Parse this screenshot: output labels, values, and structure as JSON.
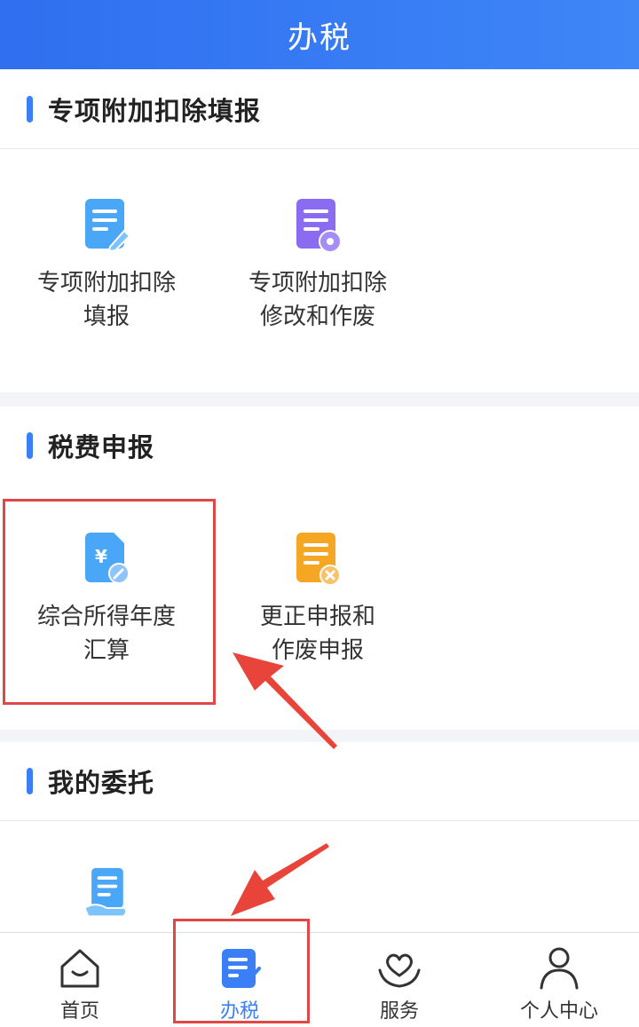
{
  "header": {
    "title": "办税"
  },
  "sections": {
    "special": {
      "title": "专项附加扣除填报",
      "items": [
        {
          "label": "专项附加扣除\n填报",
          "icon": "document-edit-icon",
          "color": "#3fa0f5"
        },
        {
          "label": "专项附加扣除\n修改和作废",
          "icon": "document-settings-icon",
          "color": "#8b6cf0"
        }
      ]
    },
    "tax": {
      "title": "税费申报",
      "items": [
        {
          "label": "综合所得年度\n汇算",
          "icon": "yuan-document-edit-icon",
          "color": "#3fa0f5"
        },
        {
          "label": "更正申报和\n作废申报",
          "icon": "document-cancel-icon",
          "color": "#f5a623"
        }
      ]
    },
    "entrust": {
      "title": "我的委托",
      "items": [
        {
          "icon": "document-hand-icon",
          "color": "#3fa0f5"
        }
      ]
    }
  },
  "nav": {
    "items": [
      {
        "label": "首页",
        "icon": "home-icon"
      },
      {
        "label": "办税",
        "icon": "tax-document-icon",
        "active": true
      },
      {
        "label": "服务",
        "icon": "heart-hands-icon"
      },
      {
        "label": "个人中心",
        "icon": "person-icon"
      }
    ]
  },
  "colors": {
    "accent": "#3a7ff6",
    "highlight": "#e04848"
  }
}
